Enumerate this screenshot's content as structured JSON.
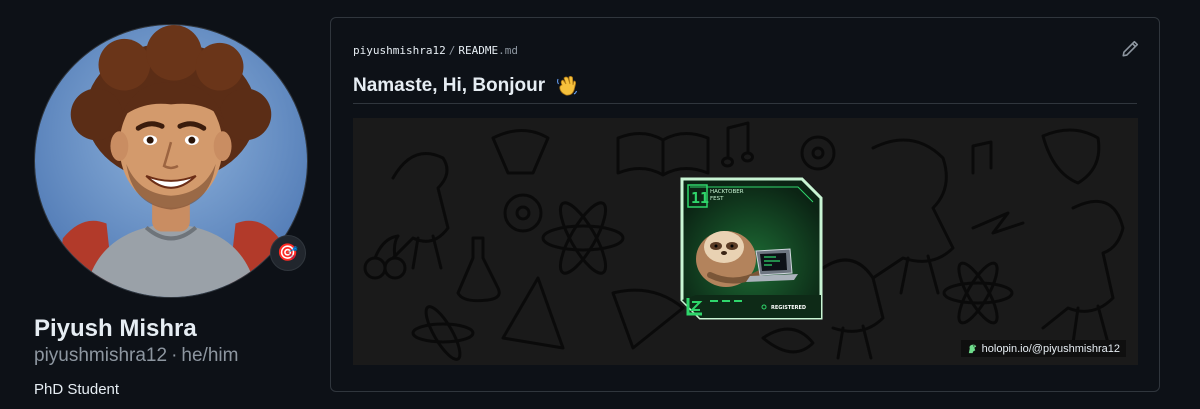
{
  "profile": {
    "name": "Piyush Mishra",
    "login": "piyushmishra12",
    "pronouns": "he/him",
    "separator": "·",
    "bio": "PhD Student",
    "status_emoji": "🎯"
  },
  "readme": {
    "path_user": "piyushmishra12",
    "path_separator": "/",
    "file_name": "README",
    "file_ext": ".md",
    "heading": "Namaste, Hi, Bonjour",
    "heading_icon": "waving-hand-icon",
    "badge": {
      "brand_number": "11",
      "title_line1": "HACKTOBER",
      "title_line2": "FEST",
      "status": "REGISTERED"
    },
    "holopin_link": "holopin.io/@piyushmishra12"
  },
  "colors": {
    "background": "#0d1117",
    "border": "#30363d",
    "muted_text": "#8d96a0",
    "badge_green": "#2fd66b",
    "banner_bg": "#1a1a1a"
  }
}
